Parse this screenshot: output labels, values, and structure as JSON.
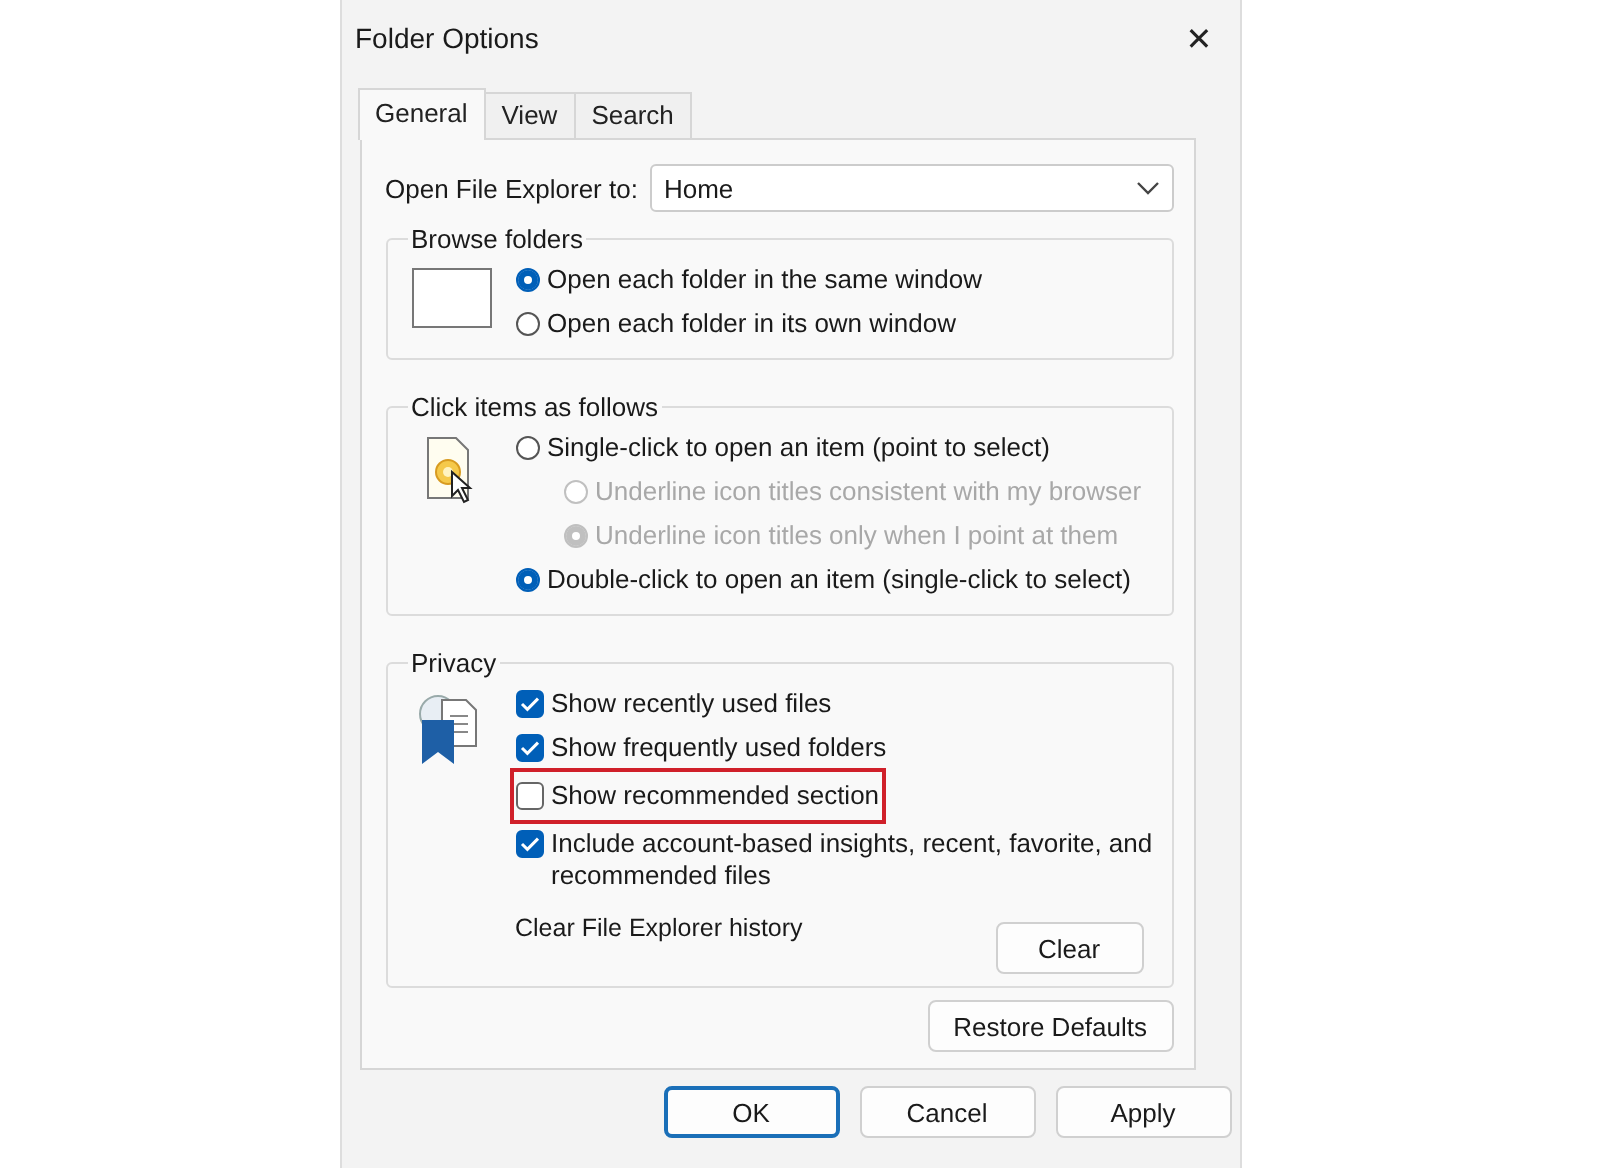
{
  "window": {
    "title": "Folder Options",
    "close": "✕"
  },
  "tabs": [
    {
      "label": "General",
      "selected": true
    },
    {
      "label": "View",
      "selected": false
    },
    {
      "label": "Search",
      "selected": false
    }
  ],
  "open_explorer": {
    "label": "Open File Explorer to:",
    "value": "Home"
  },
  "groups": [
    {
      "title": "Browse folders",
      "kind": "window",
      "options": [
        {
          "kind": "radio",
          "label": "Open each folder in the same window",
          "selected": true,
          "disabled": false
        },
        {
          "kind": "radio",
          "label": "Open each folder in its own window",
          "selected": false,
          "disabled": false
        }
      ]
    },
    {
      "title": "Click items as follows",
      "kind": "click",
      "options": [
        {
          "kind": "radio",
          "label": "Single-click to open an item (point to select)",
          "selected": false,
          "disabled": false,
          "children": [
            {
              "kind": "radio",
              "label": "Underline icon titles consistent with my browser",
              "selected": false,
              "disabled": true
            },
            {
              "kind": "radio",
              "label": "Underline icon titles only when I point at them",
              "selected": true,
              "disabled": true
            }
          ]
        },
        {
          "kind": "radio",
          "label": "Double-click to open an item (single-click to select)",
          "selected": true,
          "disabled": false
        }
      ]
    },
    {
      "title": "Privacy",
      "kind": "privacy",
      "options": [
        {
          "kind": "checkbox",
          "label": "Show recently used files",
          "checked": true,
          "highlighted": false
        },
        {
          "kind": "checkbox",
          "label": "Show frequently used folders",
          "checked": true,
          "highlighted": false
        },
        {
          "kind": "checkbox",
          "label": "Show recommended section",
          "checked": false,
          "highlighted": true
        },
        {
          "kind": "checkbox",
          "label": "Include account-based insights, recent, favorite, and recommended files",
          "checked": true,
          "highlighted": false
        }
      ],
      "clear": {
        "label": "Clear File Explorer history",
        "button": "Clear"
      }
    }
  ],
  "restore_button": "Restore Defaults",
  "footer_buttons": [
    {
      "label": "OK",
      "default": true
    },
    {
      "label": "Cancel",
      "default": false
    },
    {
      "label": "Apply",
      "default": false
    }
  ]
}
